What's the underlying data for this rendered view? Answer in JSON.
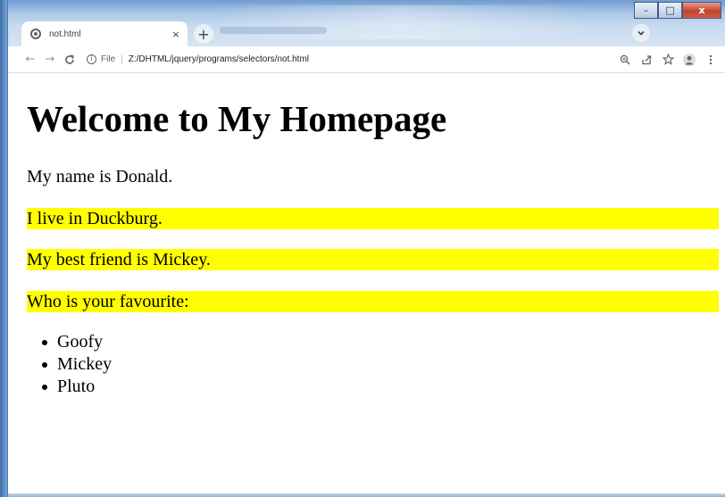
{
  "browser": {
    "tab": {
      "title": "not.html",
      "close_glyph": "×",
      "favicon": "globe-icon"
    },
    "new_tab_glyph": "+",
    "window_controls": {
      "minimize": "–",
      "maximize": "□",
      "close": "x"
    },
    "toolbar": {
      "back_glyph": "←",
      "forward_glyph": "→",
      "reload_glyph": "C",
      "scheme_label": "File",
      "separator": "|",
      "url": "Z:/DHTML/jquery/programs/selectors/not.html"
    }
  },
  "page": {
    "heading": "Welcome to My Homepage",
    "paragraphs": [
      {
        "text": "My name is Donald.",
        "highlighted": false
      },
      {
        "text": "I live in Duckburg.",
        "highlighted": true
      },
      {
        "text": "My best friend is Mickey.",
        "highlighted": true
      },
      {
        "text": "Who is your favourite:",
        "highlighted": true
      }
    ],
    "list_items": [
      "Goofy",
      "Mickey",
      "Pluto"
    ]
  },
  "colors": {
    "highlight": "#ffff00",
    "text": "#000000",
    "chrome_frame": "#a9c6e6"
  }
}
